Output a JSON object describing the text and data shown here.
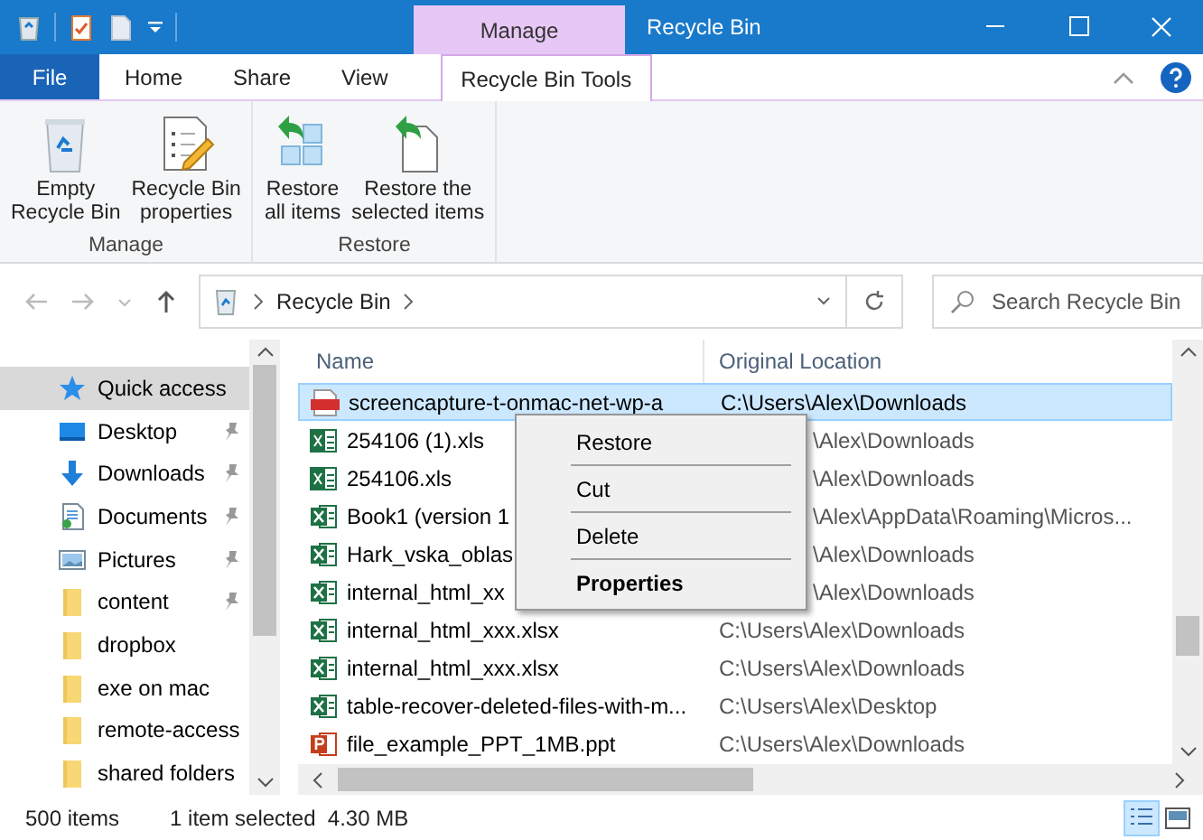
{
  "window": {
    "title": "Recycle Bin",
    "context_tab": "Manage"
  },
  "ribbon_tabs": [
    {
      "label": "File",
      "kind": "file",
      "selected": false
    },
    {
      "label": "Home",
      "kind": "tab",
      "selected": false
    },
    {
      "label": "Share",
      "kind": "tab",
      "selected": false
    },
    {
      "label": "View",
      "kind": "tab",
      "selected": false
    },
    {
      "label": "Recycle Bin Tools",
      "kind": "context",
      "selected": true
    }
  ],
  "ribbon_groups": [
    {
      "label": "Manage",
      "buttons": [
        {
          "label": "Empty\nRecycle Bin",
          "kind": "empty"
        },
        {
          "label": "Recycle Bin\nproperties",
          "kind": "properties"
        }
      ]
    },
    {
      "label": "Restore",
      "buttons": [
        {
          "label": "Restore\nall items",
          "kind": "restore_all"
        },
        {
          "label": "Restore the\nselected items",
          "kind": "restore_selected"
        }
      ]
    }
  ],
  "address": {
    "path": "Recycle Bin"
  },
  "search": {
    "placeholder": "Search Recycle Bin"
  },
  "nav": [
    {
      "label": "Quick access",
      "kind": "quick",
      "pinned": false,
      "selected": true
    },
    {
      "label": "Desktop",
      "kind": "desktop",
      "pinned": true,
      "selected": false
    },
    {
      "label": "Downloads",
      "kind": "downloads",
      "pinned": true,
      "selected": false
    },
    {
      "label": "Documents",
      "kind": "documents",
      "pinned": true,
      "selected": false
    },
    {
      "label": "Pictures",
      "kind": "pictures",
      "pinned": true,
      "selected": false
    },
    {
      "label": "content",
      "kind": "folder",
      "pinned": true,
      "selected": false
    },
    {
      "label": "dropbox",
      "kind": "folder",
      "pinned": false,
      "selected": false
    },
    {
      "label": "exe on mac",
      "kind": "folder",
      "pinned": false,
      "selected": false
    },
    {
      "label": "remote-access",
      "kind": "folder",
      "pinned": false,
      "selected": false
    },
    {
      "label": "shared folders",
      "kind": "folder",
      "pinned": false,
      "selected": false
    }
  ],
  "table": {
    "columns": [
      "Name",
      "Original Location"
    ],
    "rows": [
      {
        "name": "screencapture-t-onmac-net-wp-a",
        "location": "C:\\Users\\Alex\\Downloads",
        "kind": "pdf",
        "selected": true
      },
      {
        "name": "254106 (1).xls",
        "location": "\\Alex\\Downloads",
        "kind": "xls",
        "selected": false
      },
      {
        "name": "254106.xls",
        "location": "\\Alex\\Downloads",
        "kind": "xls",
        "selected": false
      },
      {
        "name": "Book1 (version 1",
        "location": "\\Alex\\AppData\\Roaming\\Micros...",
        "kind": "xlsx",
        "selected": false
      },
      {
        "name": "Hark_vska_oblas",
        "location": "\\Alex\\Downloads",
        "kind": "xlsx",
        "selected": false
      },
      {
        "name": "internal_html_xx",
        "location": "\\Alex\\Downloads",
        "kind": "xlsx",
        "selected": false
      },
      {
        "name": "internal_html_xxx.xlsx",
        "location": "C:\\Users\\Alex\\Downloads",
        "kind": "xlsx",
        "selected": false
      },
      {
        "name": "internal_html_xxx.xlsx",
        "location": "C:\\Users\\Alex\\Downloads",
        "kind": "xlsx",
        "selected": false
      },
      {
        "name": "table-recover-deleted-files-with-m...",
        "location": "C:\\Users\\Alex\\Desktop",
        "kind": "xlsx",
        "selected": false
      },
      {
        "name": "file_example_PPT_1MB.ppt",
        "location": "C:\\Users\\Alex\\Downloads",
        "kind": "ppt",
        "selected": false
      }
    ]
  },
  "context_menu": [
    {
      "label": "Restore",
      "default": false
    },
    {
      "label": "Cut",
      "default": false
    },
    {
      "label": "Delete",
      "default": false
    },
    {
      "label": "Properties",
      "default": true
    }
  ],
  "status_bar": {
    "count": "500 items",
    "selection": "1 item selected  4.30 MB"
  }
}
